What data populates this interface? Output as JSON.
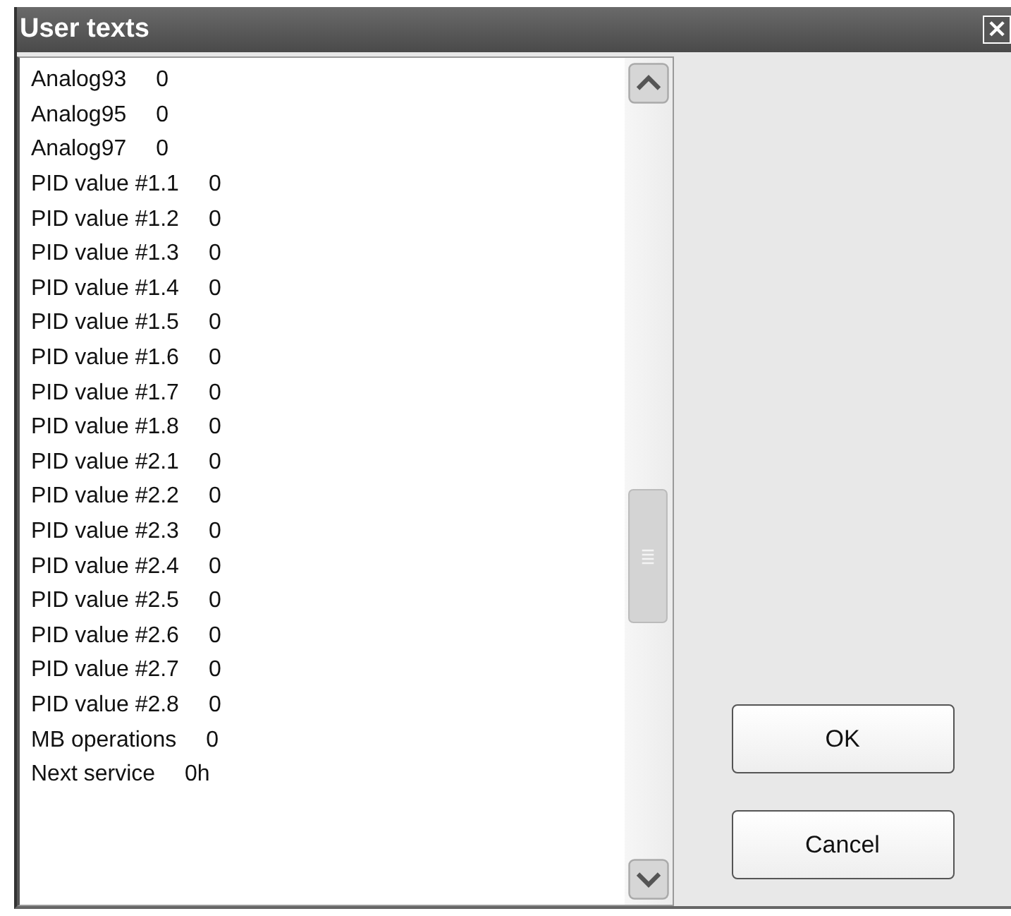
{
  "window": {
    "title": "User texts",
    "close_glyph": "×"
  },
  "items": [
    {
      "name": "Analog93",
      "value": "0"
    },
    {
      "name": "Analog95",
      "value": "0"
    },
    {
      "name": "Analog97",
      "value": "0"
    },
    {
      "name": "PID value #1.1",
      "value": "0"
    },
    {
      "name": "PID value #1.2",
      "value": "0"
    },
    {
      "name": "PID value #1.3",
      "value": "0"
    },
    {
      "name": "PID value #1.4",
      "value": "0"
    },
    {
      "name": "PID value #1.5",
      "value": "0"
    },
    {
      "name": "PID value #1.6",
      "value": "0"
    },
    {
      "name": "PID value #1.7",
      "value": "0"
    },
    {
      "name": "PID value #1.8",
      "value": "0"
    },
    {
      "name": "PID value #2.1",
      "value": "0"
    },
    {
      "name": "PID value #2.2",
      "value": "0"
    },
    {
      "name": "PID value #2.3",
      "value": "0"
    },
    {
      "name": "PID value #2.4",
      "value": "0"
    },
    {
      "name": "PID value #2.5",
      "value": "0"
    },
    {
      "name": "PID value #2.6",
      "value": "0"
    },
    {
      "name": "PID value #2.7",
      "value": "0"
    },
    {
      "name": "PID value #2.8",
      "value": "0"
    },
    {
      "name": "MB operations",
      "value": "0"
    },
    {
      "name": "Next service",
      "value": "0h"
    }
  ],
  "buttons": [
    "OK",
    "Cancel"
  ]
}
